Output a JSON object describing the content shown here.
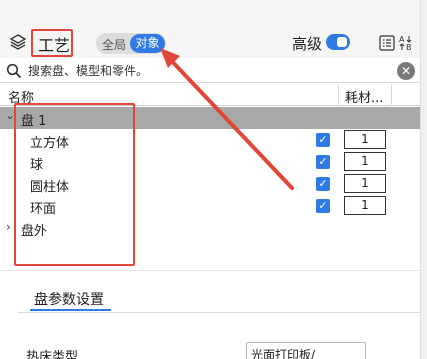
{
  "toolbar": {
    "title": "工艺",
    "segment": {
      "all_label": "全局",
      "object_label": "对象",
      "selected": "对象"
    },
    "advanced_label": "高级",
    "advanced_enabled": true
  },
  "search": {
    "placeholder": "搜索盘、模型和零件。",
    "clear_icon": "clear-icon",
    "clear_glyph": "✕",
    "search_icon": "search-icon"
  },
  "table": {
    "col_name": "名称",
    "col_material": "耗材..."
  },
  "tree": {
    "plate_expanded_glyph": "⌄",
    "plate_collapsed_glyph": "›",
    "plate": {
      "label": "盘 1",
      "expanded": true,
      "selected": true
    },
    "objects": [
      {
        "label": "立方体",
        "checked": true,
        "qty": "1"
      },
      {
        "label": "球",
        "checked": true,
        "qty": "1"
      },
      {
        "label": "圆柱体",
        "checked": true,
        "qty": "1"
      },
      {
        "label": "环面",
        "checked": true,
        "qty": "1"
      }
    ],
    "outside": {
      "label": "盘外",
      "expanded": false
    },
    "check_glyph": "✓"
  },
  "settings": {
    "tab_label": "盘参数设置",
    "bed_type_label": "热床类型",
    "bed_type_value": "光面打印板/"
  },
  "colors": {
    "accent": "#2f7ae5",
    "annotation_red": "#e0463a",
    "selected_row": "#a8a8a8"
  }
}
